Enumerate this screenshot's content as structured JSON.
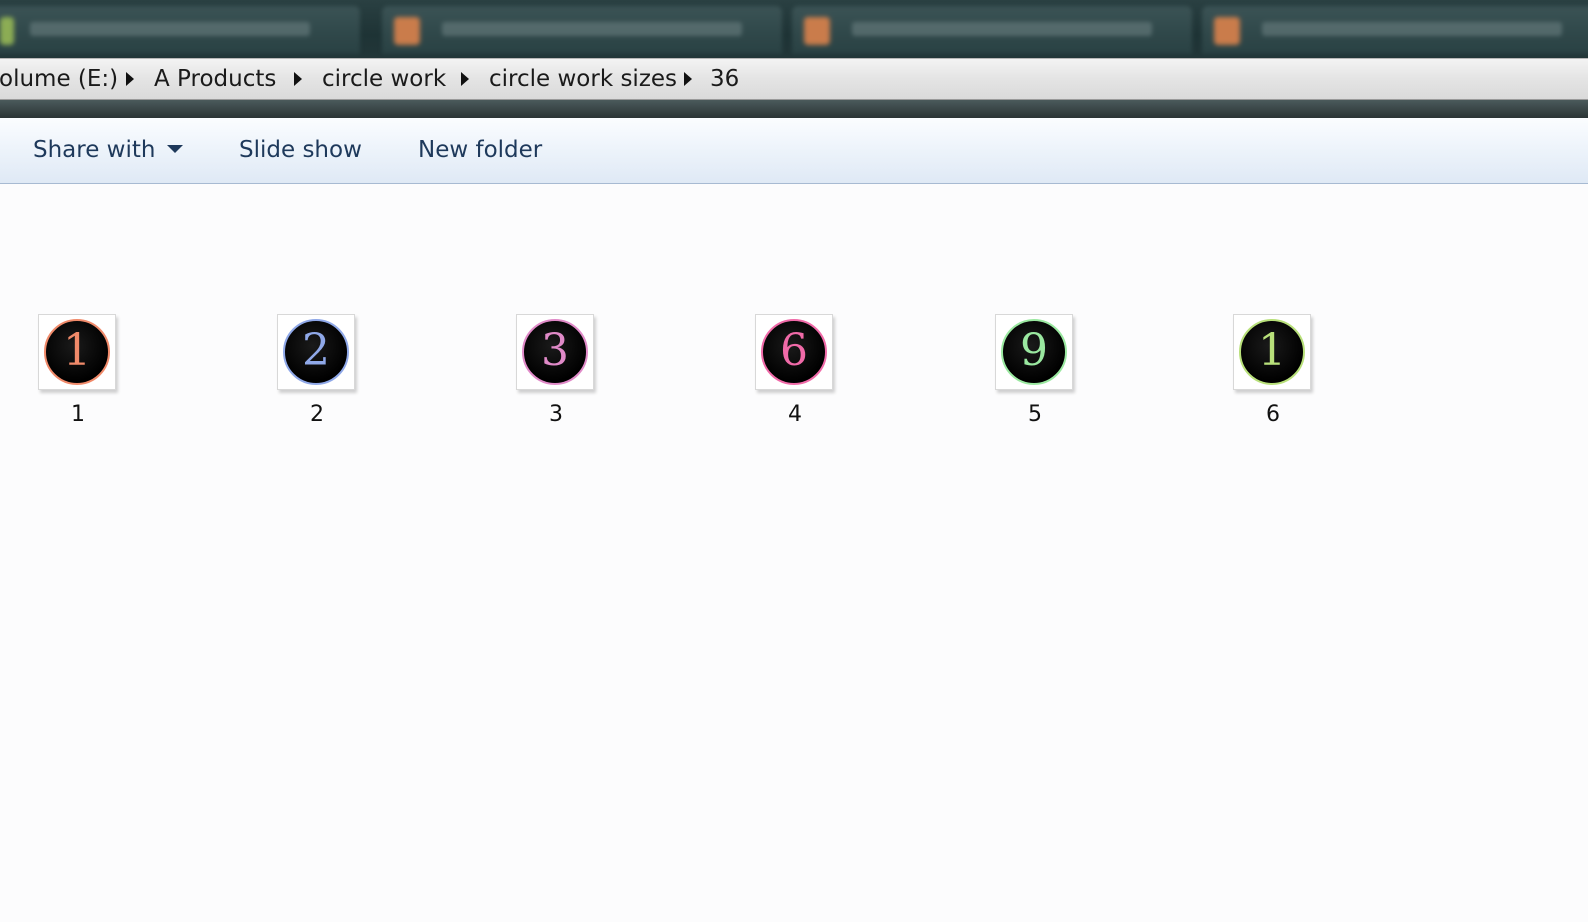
{
  "breadcrumb": {
    "items": [
      "olume (E:)",
      "A Products",
      "circle work",
      "circle work sizes",
      "36"
    ]
  },
  "toolbar": {
    "share_with": "Share with",
    "slide_show": "Slide show",
    "new_folder": "New folder"
  },
  "files": [
    {
      "name": "1",
      "glyph": "1",
      "color": "#f08a6a"
    },
    {
      "name": "2",
      "glyph": "2",
      "color": "#8fa8e8"
    },
    {
      "name": "3",
      "glyph": "3",
      "color": "#e08ac8"
    },
    {
      "name": "4",
      "glyph": "6",
      "color": "#f06aa8"
    },
    {
      "name": "5",
      "glyph": "9",
      "color": "#9ae8a0"
    },
    {
      "name": "6",
      "glyph": "1",
      "color": "#b8e07a"
    }
  ]
}
